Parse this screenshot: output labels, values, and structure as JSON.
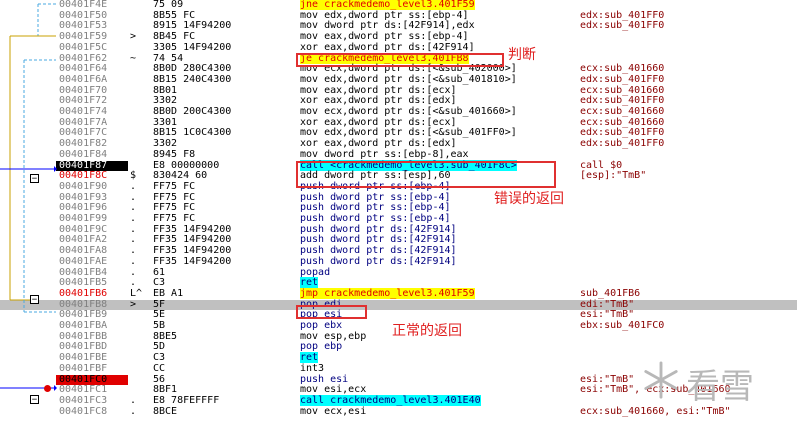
{
  "rows": [
    {
      "addr": "00401F4E",
      "mark": "",
      "bytes": "75 09",
      "disasm": "jne crackmedemo_level3.401F59",
      "cmt": "",
      "kind": "jmp"
    },
    {
      "addr": "00401F50",
      "mark": "",
      "bytes": "8B55 FC",
      "disasm": "mov edx,dword ptr ss:[ebp-4]",
      "cmt": "edx:sub_401FF0"
    },
    {
      "addr": "00401F53",
      "mark": "",
      "bytes": "8915 14F94200",
      "disasm": "mov dword ptr ds:[42F914],edx",
      "cmt": "edx:sub_401FF0"
    },
    {
      "addr": "00401F59",
      "mark": ">",
      "bytes": "8B45 FC",
      "disasm": "mov eax,dword ptr ss:[ebp-4]",
      "cmt": ""
    },
    {
      "addr": "00401F5C",
      "mark": "",
      "bytes": "3305 14F94200",
      "disasm": "xor eax,dword ptr ds:[42F914]",
      "cmt": ""
    },
    {
      "addr": "00401F62",
      "mark": "~",
      "bytes": "74 54",
      "disasm": "je crackmedemo_level3.401FB8",
      "cmt": "",
      "kind": "jmp"
    },
    {
      "addr": "00401F64",
      "mark": "",
      "bytes": "8B0D 280C4300",
      "disasm": "mov ecx,dword ptr ds:[<&sub_402000>]",
      "cmt": "ecx:sub_401660"
    },
    {
      "addr": "00401F6A",
      "mark": "",
      "bytes": "8B15 240C4300",
      "disasm": "mov edx,dword ptr ds:[<&sub_401810>]",
      "cmt": "edx:sub_401FF0"
    },
    {
      "addr": "00401F70",
      "mark": "",
      "bytes": "8B01",
      "disasm": "mov eax,dword ptr ds:[ecx]",
      "cmt": "ecx:sub_401660"
    },
    {
      "addr": "00401F72",
      "mark": "",
      "bytes": "3302",
      "disasm": "xor eax,dword ptr ds:[edx]",
      "cmt": "edx:sub_401FF0"
    },
    {
      "addr": "00401F74",
      "mark": "",
      "bytes": "8B0D 200C4300",
      "disasm": "mov ecx,dword ptr ds:[<&sub_401660>]",
      "cmt": "ecx:sub_401660"
    },
    {
      "addr": "00401F7A",
      "mark": "",
      "bytes": "3301",
      "disasm": "xor eax,dword ptr ds:[ecx]",
      "cmt": "ecx:sub_401660"
    },
    {
      "addr": "00401F7C",
      "mark": "",
      "bytes": "8B15 1C0C4300",
      "disasm": "mov edx,dword ptr ds:[<&sub_401FF0>]",
      "cmt": "edx:sub_401FF0"
    },
    {
      "addr": "00401F82",
      "mark": "",
      "bytes": "3302",
      "disasm": "xor eax,dword ptr ds:[edx]",
      "cmt": "edx:sub_401FF0"
    },
    {
      "addr": "00401F84",
      "mark": "",
      "bytes": "8945 F8",
      "disasm": "mov dword ptr ss:[ebp-8],eax",
      "cmt": ""
    },
    {
      "addr": "00401F87",
      "mark": "",
      "bytes": "E8 00000000",
      "disasm": "call <crackmedemo_level3.sub_401F8C>",
      "cmt": "call $0",
      "kind": "call",
      "addrStyle": "eip"
    },
    {
      "addr": "00401F8C",
      "mark": "$",
      "bytes": "830424 60",
      "disasm": "add dword ptr ss:[esp],60",
      "cmt": "[esp]:\"TmB\"",
      "addrStyle": "lbl"
    },
    {
      "addr": "00401F90",
      "mark": ".",
      "bytes": "FF75 FC",
      "disasm": "push dword ptr ss:[ebp-4]",
      "cmt": "",
      "kind": "push"
    },
    {
      "addr": "00401F93",
      "mark": ".",
      "bytes": "FF75 FC",
      "disasm": "push dword ptr ss:[ebp-4]",
      "cmt": "",
      "kind": "push"
    },
    {
      "addr": "00401F96",
      "mark": ".",
      "bytes": "FF75 FC",
      "disasm": "push dword ptr ss:[ebp-4]",
      "cmt": "",
      "kind": "push"
    },
    {
      "addr": "00401F99",
      "mark": ".",
      "bytes": "FF75 FC",
      "disasm": "push dword ptr ss:[ebp-4]",
      "cmt": "",
      "kind": "push"
    },
    {
      "addr": "00401F9C",
      "mark": ".",
      "bytes": "FF35 14F94200",
      "disasm": "push dword ptr ds:[42F914]",
      "cmt": "",
      "kind": "push"
    },
    {
      "addr": "00401FA2",
      "mark": ".",
      "bytes": "FF35 14F94200",
      "disasm": "push dword ptr ds:[42F914]",
      "cmt": "",
      "kind": "push"
    },
    {
      "addr": "00401FA8",
      "mark": ".",
      "bytes": "FF35 14F94200",
      "disasm": "push dword ptr ds:[42F914]",
      "cmt": "",
      "kind": "push"
    },
    {
      "addr": "00401FAE",
      "mark": ".",
      "bytes": "FF35 14F94200",
      "disasm": "push dword ptr ds:[42F914]",
      "cmt": "",
      "kind": "push"
    },
    {
      "addr": "00401FB4",
      "mark": ".",
      "bytes": "61",
      "disasm": "popad",
      "cmt": "",
      "kind": "push"
    },
    {
      "addr": "00401FB5",
      "mark": ".",
      "bytes": "C3",
      "disasm": "ret",
      "cmt": "",
      "kind": "ret"
    },
    {
      "addr": "00401FB6",
      "mark": "L^",
      "bytes": "EB A1",
      "disasm": "jmp crackmedemo_level3.401F59",
      "cmt": "sub_401FB6",
      "kind": "jmp",
      "addrStyle": "lbl"
    },
    {
      "addr": "00401FB8",
      "mark": ">",
      "bytes": "5F",
      "disasm": "pop edi",
      "cmt": "edi:\"TmB\"",
      "kind": "push",
      "sel": true
    },
    {
      "addr": "00401FB9",
      "mark": "",
      "bytes": "5E",
      "disasm": "pop esi",
      "cmt": "esi:\"TmB\"",
      "kind": "push"
    },
    {
      "addr": "00401FBA",
      "mark": "",
      "bytes": "5B",
      "disasm": "pop ebx",
      "cmt": "ebx:sub_401FC0",
      "kind": "push"
    },
    {
      "addr": "00401FBB",
      "mark": "",
      "bytes": "8BE5",
      "disasm": "mov esp,ebp",
      "cmt": ""
    },
    {
      "addr": "00401FBD",
      "mark": "",
      "bytes": "5D",
      "disasm": "pop ebp",
      "cmt": "",
      "kind": "push"
    },
    {
      "addr": "00401FBE",
      "mark": "",
      "bytes": "C3",
      "disasm": "ret",
      "cmt": "",
      "kind": "ret"
    },
    {
      "addr": "00401FBF",
      "mark": "",
      "bytes": "CC",
      "disasm": "int3",
      "cmt": ""
    },
    {
      "addr": "00401FC0",
      "mark": "",
      "bytes": "56",
      "disasm": "push esi",
      "cmt": "esi:\"TmB\"",
      "kind": "push",
      "addrStyle": "bp"
    },
    {
      "addr": "00401FC1",
      "mark": "",
      "bytes": "8BF1",
      "disasm": "mov esi,ecx",
      "cmt": "esi:\"TmB\", ecx:sub_401660"
    },
    {
      "addr": "00401FC3",
      "mark": ".",
      "bytes": "E8 78FEFFFF",
      "disasm": "call crackmedemo_level3.401E40",
      "cmt": "",
      "kind": "call"
    },
    {
      "addr": "00401FC8",
      "mark": ".",
      "bytes": "8BCE",
      "disasm": "mov ecx,esi",
      "cmt": "ecx:sub_401660, esi:\"TmB\""
    }
  ],
  "annotations": {
    "judge": "判断",
    "wrong_return": "错误的返回",
    "normal_return": "正常的返回"
  },
  "watermark": "看雪",
  "colors": {
    "highlight_box": "#e03030",
    "eip_bg": "#000000",
    "breakpoint": "#e00000",
    "jump_bg": "#ffff00",
    "call_bg": "#00ffff",
    "selected_row": "#c0c0c0",
    "comment": "#8a0000"
  }
}
